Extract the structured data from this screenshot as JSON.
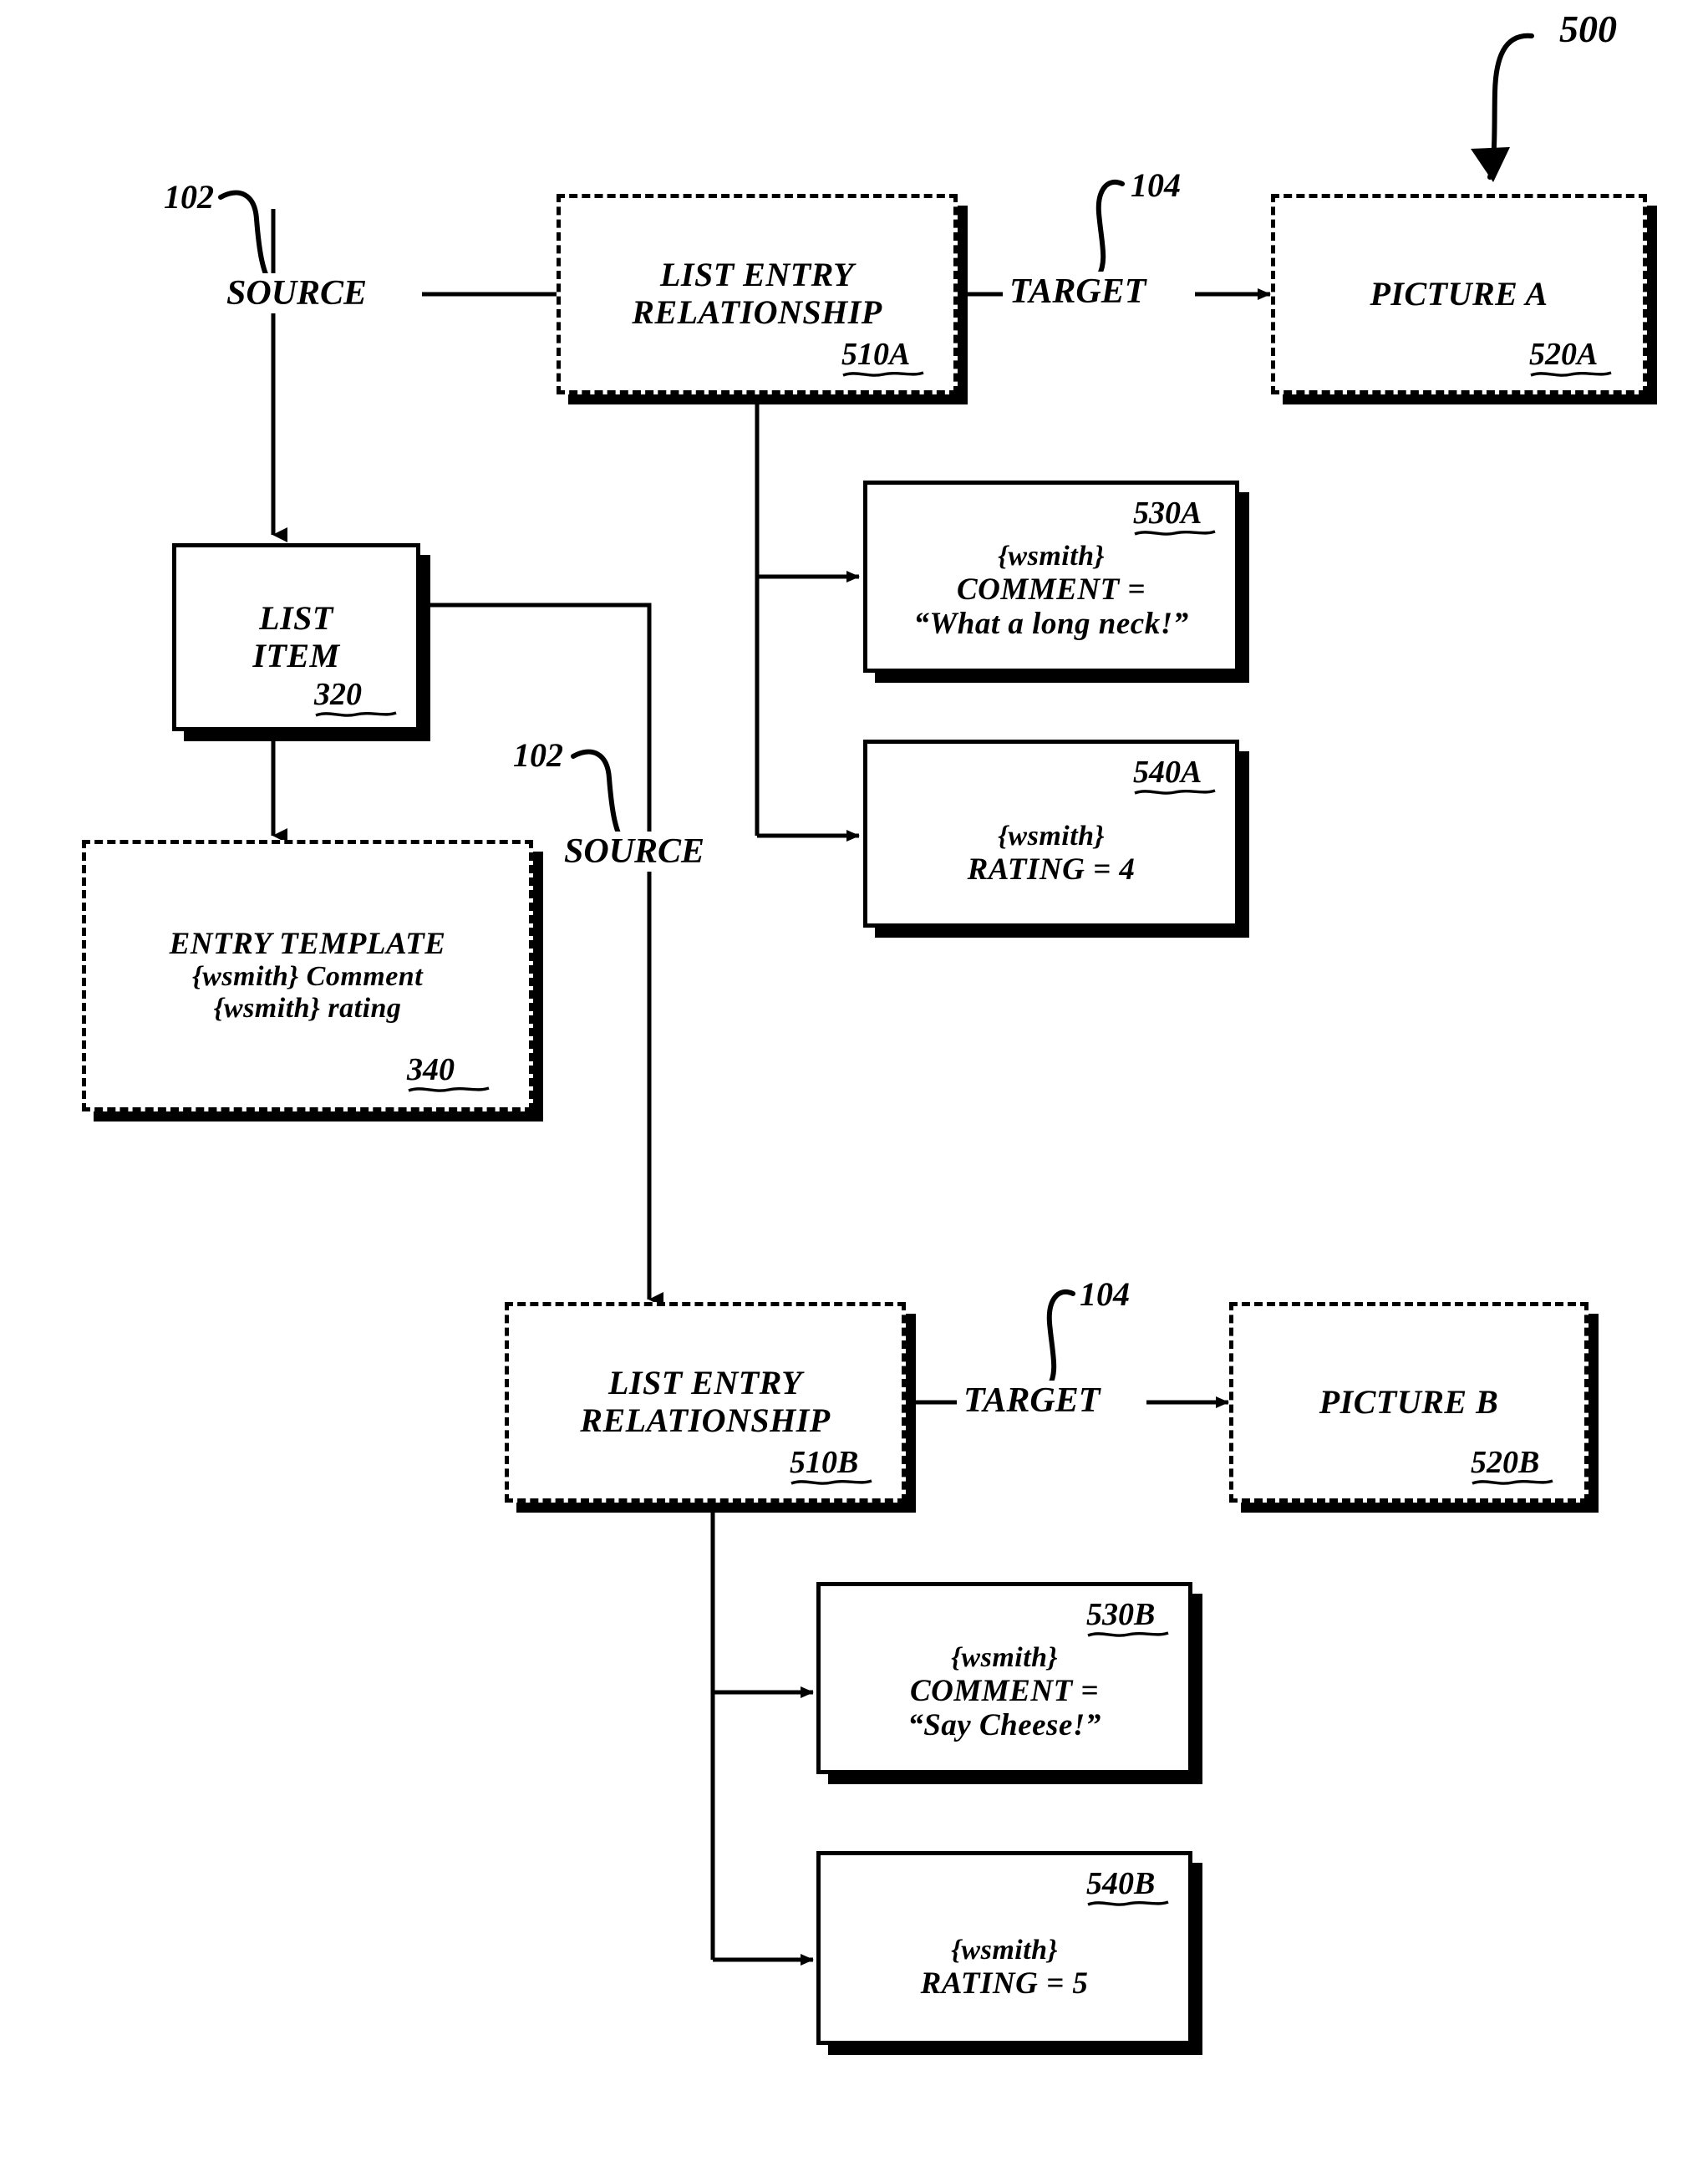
{
  "figure": {
    "number": "500"
  },
  "leaders": [
    {
      "name": "source-leader-top",
      "label": "102"
    },
    {
      "name": "target-leader-top",
      "label": "104"
    },
    {
      "name": "source-leader-middle",
      "label": "102"
    },
    {
      "name": "target-leader-bottom",
      "label": "104"
    }
  ],
  "edge_labels": {
    "source_top": "SOURCE",
    "target_top": "TARGET",
    "source_middle": "SOURCE",
    "target_bottom": "TARGET"
  },
  "nodes": {
    "list_entry_relationship_a": {
      "lines": [
        "LIST ENTRY",
        "RELATIONSHIP"
      ],
      "ref": "510A",
      "border": "dashed"
    },
    "picture_a": {
      "lines": [
        "PICTURE A"
      ],
      "ref": "520A",
      "border": "dashed"
    },
    "list_item": {
      "lines": [
        "LIST",
        "ITEM"
      ],
      "ref": "320",
      "border": "solid"
    },
    "entry_template": {
      "lines": [
        "ENTRY TEMPLATE",
        "{wsmith} Comment",
        "{wsmith} rating"
      ],
      "ref": "340",
      "border": "dashed"
    },
    "comment_a": {
      "lines": [
        "{wsmith}",
        "COMMENT =",
        "“What a long neck!”"
      ],
      "ref": "530A",
      "border": "solid"
    },
    "rating_a": {
      "lines": [
        "{wsmith}",
        "RATING = 4"
      ],
      "ref": "540A",
      "border": "solid"
    },
    "list_entry_relationship_b": {
      "lines": [
        "LIST ENTRY",
        "RELATIONSHIP"
      ],
      "ref": "510B",
      "border": "dashed"
    },
    "picture_b": {
      "lines": [
        "PICTURE B"
      ],
      "ref": "520B",
      "border": "dashed"
    },
    "comment_b": {
      "lines": [
        "{wsmith}",
        "COMMENT =",
        "“Say Cheese!”"
      ],
      "ref": "530B",
      "border": "solid"
    },
    "rating_b": {
      "lines": [
        "{wsmith}",
        "RATING = 5"
      ],
      "ref": "540B",
      "border": "solid"
    }
  },
  "colors": {
    "ink": "#000000",
    "paper": "#ffffff"
  }
}
